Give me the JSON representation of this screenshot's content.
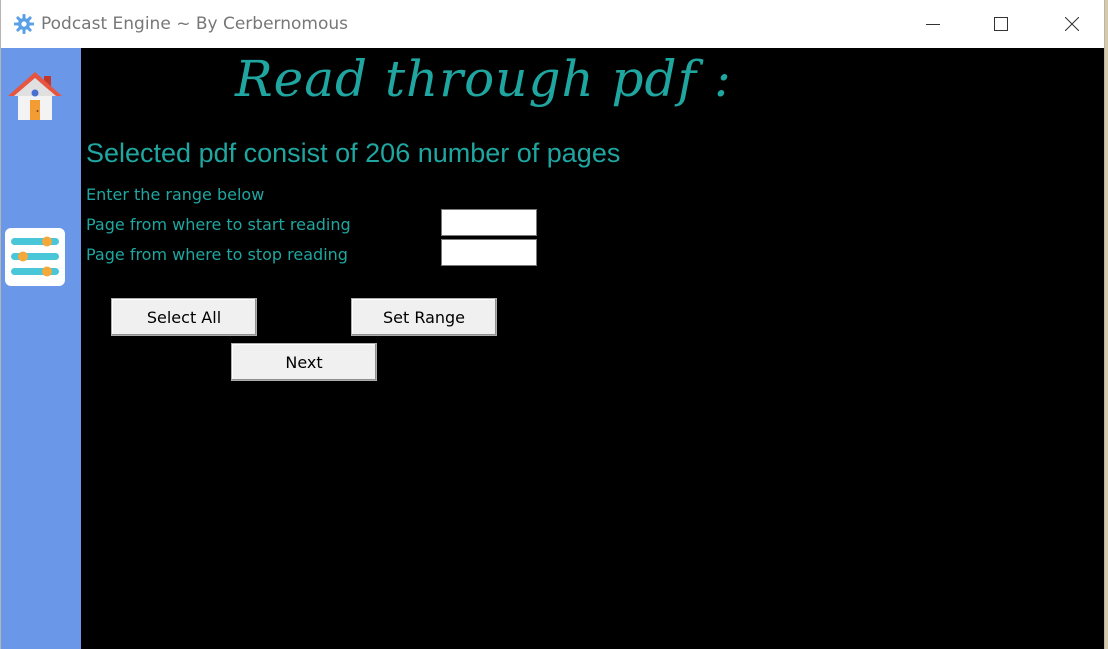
{
  "window": {
    "title": "Podcast Engine ~ By Cerbernomous",
    "icon": "gear-icon",
    "controls": [
      "minimize-icon",
      "maximize-icon",
      "close-icon"
    ]
  },
  "sidebar": {
    "background": "#6a97e8",
    "items": [
      {
        "icon": "home-icon"
      },
      {
        "icon": "settings-sliders-icon"
      }
    ]
  },
  "main": {
    "heading": "Read through pdf :",
    "info": "Selected pdf consist of 206 number of pages",
    "range_label": "Enter the range below",
    "start_label": "Page from where to start reading",
    "stop_label": "Page from where to stop reading",
    "start_value": "",
    "stop_value": "",
    "buttons": {
      "select_all": "Select All",
      "set_range": "Set Range",
      "next": "Next"
    },
    "accent_color": "#1fa6a0"
  }
}
